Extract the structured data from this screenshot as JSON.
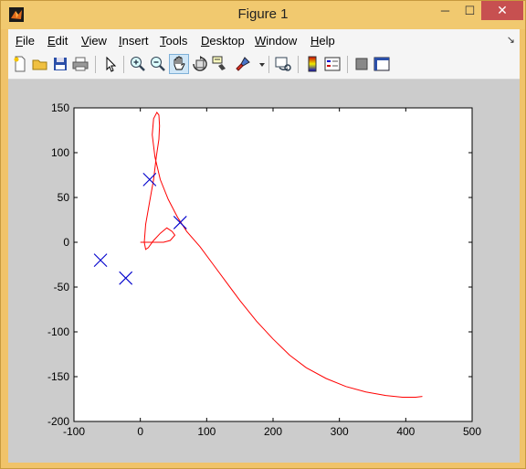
{
  "window": {
    "title": "Figure 1",
    "minimize_icon": "minimize-icon",
    "maximize_icon": "maximize-icon",
    "close_icon": "close-icon",
    "close_color": "#c75050"
  },
  "menu": {
    "items": [
      {
        "first": "F",
        "rest": "ile"
      },
      {
        "first": "E",
        "rest": "dit"
      },
      {
        "first": "V",
        "rest": "iew"
      },
      {
        "first": "I",
        "rest": "nsert"
      },
      {
        "first": "T",
        "rest": "ools"
      },
      {
        "first": "D",
        "rest": "esktop"
      },
      {
        "first": "W",
        "rest": "indow"
      },
      {
        "first": "H",
        "rest": "elp"
      }
    ]
  },
  "toolbar": {
    "icons": [
      "new-figure-icon",
      "open-file-icon",
      "save-icon",
      "print-icon",
      "edit-plot-arrow-icon",
      "zoom-in-icon",
      "zoom-out-icon",
      "pan-hand-icon",
      "rotate-3d-icon",
      "data-cursor-icon",
      "brush-icon",
      "brush-dropdown-icon",
      "link-plot-icon",
      "colorbar-icon",
      "legend-icon",
      "hide-plot-tools-icon",
      "show-plot-tools-icon"
    ],
    "pressed": "pan-hand-icon"
  },
  "chart_data": {
    "type": "line",
    "xlim": [
      -100,
      500
    ],
    "ylim": [
      -200,
      150
    ],
    "xticks": [
      -100,
      0,
      100,
      200,
      300,
      400,
      500
    ],
    "yticks": [
      150,
      100,
      50,
      0,
      -50,
      -100,
      -150,
      -200
    ],
    "xtick_labels": [
      "-100",
      "0",
      "100",
      "200",
      "300",
      "400",
      "500"
    ],
    "ytick_labels": [
      "150",
      "100",
      "50",
      "0",
      "-50",
      "-100",
      "-150",
      "-200"
    ],
    "grid": false,
    "series": [
      {
        "kind": "line",
        "color": "#ff0000",
        "x": [
          0,
          10,
          25,
          35,
          45,
          52,
          48,
          40,
          30,
          20,
          12,
          8,
          6,
          8,
          14,
          20,
          24,
          28,
          29,
          28,
          25,
          20,
          18,
          22,
          30,
          42,
          56,
          70,
          90,
          110,
          130,
          150,
          175,
          200,
          225,
          250,
          280,
          310,
          340,
          370,
          395,
          415,
          425
        ],
        "y": [
          0,
          0,
          0,
          0,
          2,
          8,
          12,
          16,
          10,
          2,
          -6,
          -8,
          0,
          20,
          45,
          70,
          95,
          115,
          130,
          142,
          145,
          138,
          120,
          95,
          70,
          48,
          28,
          12,
          -5,
          -25,
          -45,
          -65,
          -88,
          -108,
          -126,
          -140,
          -152,
          -161,
          -167,
          -171,
          -173,
          -173,
          -172
        ]
      },
      {
        "kind": "markers",
        "marker": "x",
        "color": "#0000cc",
        "x": [
          -60,
          -22,
          14,
          60
        ],
        "y": [
          -20,
          -40,
          70,
          22
        ]
      }
    ]
  }
}
